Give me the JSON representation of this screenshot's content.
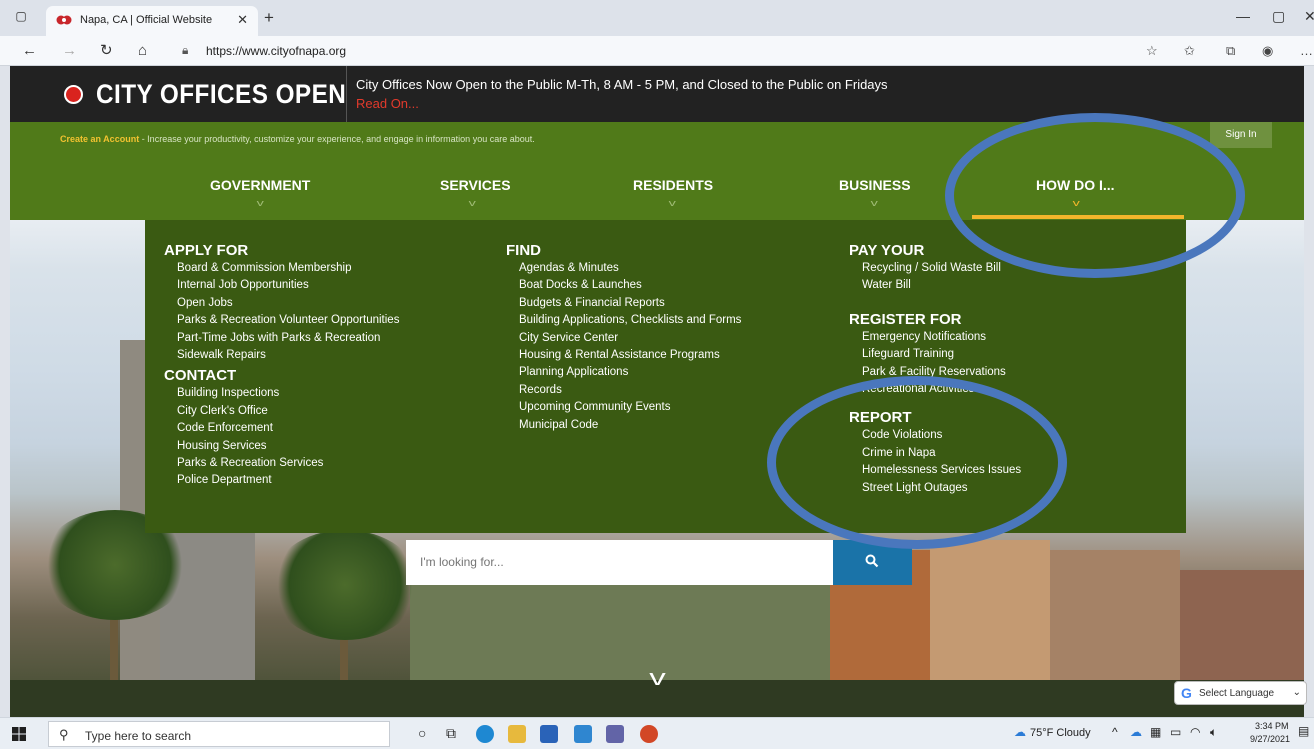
{
  "browser": {
    "tab_title": "Napa, CA | Official Website",
    "url": "https://www.cityofnapa.org"
  },
  "alert": {
    "headline": "CITY OFFICES OPEN",
    "message": "City Offices Now Open to the Public M-Th, 8 AM - 5 PM, and Closed to the Public on Fridays",
    "link": "Read On..."
  },
  "account_bar": {
    "highlight": "Create an Account",
    "text": " - Increase your productivity, customize your experience, and engage in information you care about.",
    "sign_in": "Sign In"
  },
  "nav": {
    "government": "GOVERNMENT",
    "services": "SERVICES",
    "residents": "RESIDENTS",
    "business": "BUSINESS",
    "how_do_i": "HOW DO I..."
  },
  "mega_menu": {
    "apply_for": {
      "heading": "APPLY FOR",
      "links": [
        "Board & Commission Membership",
        "Internal Job Opportunities",
        "Open Jobs",
        "Parks & Recreation Volunteer Opportunities",
        "Part-Time Jobs with Parks & Recreation",
        "Sidewalk Repairs"
      ]
    },
    "contact": {
      "heading": "CONTACT",
      "links": [
        "Building Inspections",
        "City Clerk's Office",
        "Code Enforcement",
        "Housing Services",
        "Parks & Recreation Services",
        "Police Department"
      ]
    },
    "find": {
      "heading": "FIND",
      "links": [
        "Agendas & Minutes",
        "Boat Docks & Launches",
        "Budgets & Financial Reports",
        "Building Applications, Checklists and Forms",
        "City Service Center",
        "Housing & Rental Assistance Programs",
        "Planning Applications",
        "Records",
        "Upcoming Community Events",
        "Municipal Code"
      ]
    },
    "pay_your": {
      "heading": "PAY YOUR",
      "links": [
        "Recycling / Solid Waste Bill",
        "Water Bill"
      ]
    },
    "register_for": {
      "heading": "REGISTER FOR",
      "links": [
        "Emergency Notifications",
        "Lifeguard Training",
        "Park & Facility Reservations",
        "Recreational Activities"
      ]
    },
    "report": {
      "heading": "REPORT",
      "links": [
        "Code Violations",
        "Crime in Napa",
        "Homelessness Services Issues",
        "Street Light Outages"
      ]
    }
  },
  "search": {
    "placeholder": "I'm looking for..."
  },
  "language": {
    "label": "Select Language"
  },
  "taskbar": {
    "search_placeholder": "Type here to search",
    "weather": "75°F  Cloudy",
    "time": "3:34 PM",
    "date": "9/27/2021"
  },
  "colors": {
    "nav_green": "#507a19",
    "menu_green": "#3a5a12",
    "accent_gold": "#f2b62b",
    "alert_red": "#d9231e",
    "search_blue": "#1a73a8",
    "highlight_oval": "#4a77bd"
  }
}
